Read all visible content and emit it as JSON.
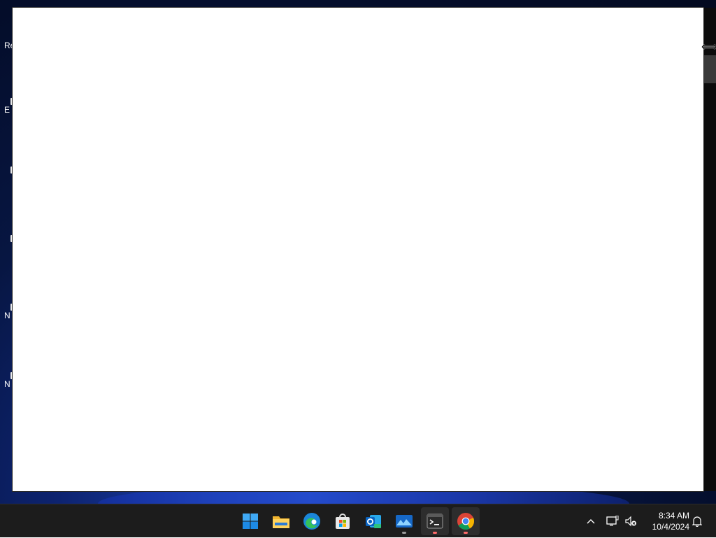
{
  "desktop": {
    "icons": [
      {
        "label": "Re",
        "icon": "recycle-bin-icon"
      },
      {
        "label": "E",
        "icon": "app-icon"
      },
      {
        "label": "",
        "icon": "app-icon"
      },
      {
        "label": "",
        "icon": "app-icon"
      },
      {
        "label": "N",
        "icon": "app-icon"
      },
      {
        "label": "N",
        "icon": "app-icon"
      }
    ]
  },
  "taskbar": {
    "apps": [
      {
        "name": "Start",
        "icon": "windows-start-icon"
      },
      {
        "name": "File Explorer",
        "icon": "folder-icon"
      },
      {
        "name": "Microsoft Edge",
        "icon": "edge-icon"
      },
      {
        "name": "Microsoft Store",
        "icon": "store-icon"
      },
      {
        "name": "Outlook (new)",
        "icon": "outlook-icon"
      },
      {
        "name": "Photos",
        "icon": "photos-icon"
      },
      {
        "name": "Terminal",
        "icon": "terminal-icon"
      },
      {
        "name": "Google Chrome",
        "icon": "chrome-icon"
      }
    ],
    "tray": {
      "chevron": "chevron-up-icon",
      "network": "network-icon",
      "volume": "volume-muted-icon",
      "notifications": "bell-icon"
    },
    "clock": {
      "time": "8:34 AM",
      "date": "10/4/2024"
    }
  },
  "colors": {
    "taskbar": "#1c1c1c",
    "window": "#ffffff",
    "accent_blue": "#1d3cb6"
  }
}
